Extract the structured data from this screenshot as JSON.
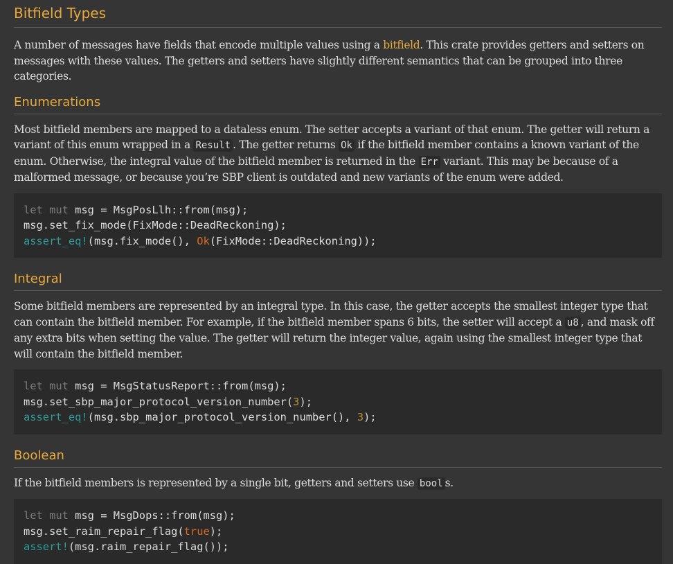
{
  "title": "Bitfield Types",
  "intro": {
    "before_link": "A number of messages have fields that encode multiple values using a ",
    "link_text": "bitfield",
    "after_link": ". This crate provides getters and setters on messages with these values. The getters and setters have slightly different semantics that can be grouped into three categories."
  },
  "enumerations": {
    "heading": "Enumerations",
    "text1": "Most bitfield members are mapped to a dataless enum. The setter accepts a variant of that enum. The getter will return a variant of this enum wrapped in a ",
    "code1": "Result",
    "text2": ". The getter returns ",
    "code2": "Ok",
    "text3": " if the bitfield member contains a known variant of the enum. Otherwise, the integral value of the bitfield member is returned in the ",
    "code3": "Err",
    "text4": " variant. This may be because of a malformed message, or because you’re SBP client is outdated and new variants of the enum were added.",
    "code": {
      "l1_kw": "let mut",
      "l1_rest": " msg = MsgPosLlh::from(msg);",
      "l2": "msg.set_fix_mode(FixMode::DeadReckoning);",
      "l3_macro": "assert_eq!",
      "l3_a": "(msg.fix_mode(), ",
      "l3_ok": "Ok",
      "l3_b": "(FixMode::DeadReckoning));"
    }
  },
  "integral": {
    "heading": "Integral",
    "text1": "Some bitfield members are represented by an integral type. In this case, the getter accepts the smallest integer type that can contain the bitfield member. For example, if the bitfield member spans 6 bits, the setter will accept a ",
    "code1": "u8",
    "text2": ", and mask off any extra bits when setting the value. The getter will return the integer value, again using the smallest integer type that will contain the bitfield member.",
    "code": {
      "l1_kw": "let mut",
      "l1_rest": " msg = MsgStatusReport::from(msg);",
      "l2_a": "msg.set_sbp_major_protocol_version_number(",
      "l2_num": "3",
      "l2_b": ");",
      "l3_macro": "assert_eq!",
      "l3_a": "(msg.sbp_major_protocol_version_number(), ",
      "l3_num": "3",
      "l3_b": ");"
    }
  },
  "boolean": {
    "heading": "Boolean",
    "text1": "If the bitfield members is represented by a single bit, getters and setters use ",
    "code1": "bool",
    "text2": "s.",
    "code": {
      "l1_kw": "let mut",
      "l1_rest": " msg = MsgDops::from(msg);",
      "l2_a": "msg.set_raim_repair_flag(",
      "l2_true": "true",
      "l2_b": ");",
      "l3_macro": "assert!",
      "l3_a": "(msg.raim_repair_flag());"
    }
  }
}
